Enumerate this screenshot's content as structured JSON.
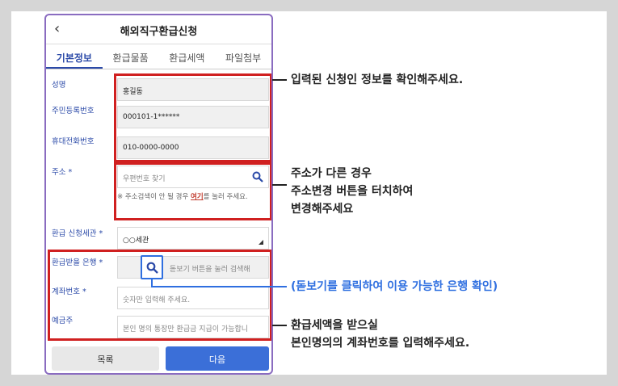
{
  "header": {
    "back_icon": "‹",
    "title": "해외직구환급신청"
  },
  "tabs": [
    {
      "label": "기본정보",
      "active": true
    },
    {
      "label": "환급물품",
      "active": false
    },
    {
      "label": "환급세액",
      "active": false
    },
    {
      "label": "파일첨부",
      "active": false
    }
  ],
  "fields": {
    "name_label": "성명",
    "name_value": "홍길동",
    "id_label": "주민등록번호",
    "id_value": "000101-1******",
    "phone_label": "휴대전화번호",
    "phone_value": "010-0000-0000",
    "address_label": "주소",
    "address_placeholder": "우편번호 찾기",
    "address_note_pre": "※ 주소검색이 안 될 경우 ",
    "address_note_link": "여기",
    "address_note_post": "를 눌러 주세요.",
    "customs_label": "환급 신청세관",
    "customs_value": "○○세관",
    "bank_label": "환급받을 은행",
    "bank_hint": "돋보기 버튼을 눌러 검색해",
    "account_label": "계좌번호",
    "account_placeholder": "숫자만 입력해 주세요.",
    "holder_label": "예금주",
    "holder_placeholder": "본인 명의 통장만 환급금 지급이 가능합니",
    "required_mark": "*"
  },
  "buttons": {
    "list": "목록",
    "next": "다음"
  },
  "annotations": {
    "info": "입력된 신청인 정보를 확인해주세요.",
    "address_line1": "주소가 다른 경우",
    "address_line2": "주소변경 버튼을 터치하여",
    "address_line3": "변경해주세요",
    "bank": "(돋보기를 클릭하여 이용 가능한 은행 확인)",
    "account_line1": "환급세액을 받으실",
    "account_line2": "본인명의의 계좌번호를 입력해주세요."
  },
  "colors": {
    "accent": "#2b4aa8",
    "highlight_red": "#d02020",
    "highlight_blue": "#2f6fe0"
  }
}
